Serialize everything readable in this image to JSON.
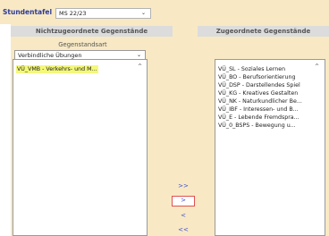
{
  "stundentafel": {
    "label": "Stundentafel",
    "value": "MS 22/23"
  },
  "headers": {
    "left": "Nichtzugeordnete Gegenstände",
    "right": "Zugeordnete Gegenstände"
  },
  "gegenstandsart": {
    "label": "Gegenstandsart",
    "value": "Verbindliche Übungen"
  },
  "left_list": [
    "VÜ_VMB - Verkehrs- und M..."
  ],
  "right_list": [
    "VÜ_SL - Soziales Lernen",
    "VÜ_BO - Berufsorientierung",
    "VÜ_DSP - Darstellendes Spiel",
    "VÜ_KG - Kreatives Gestalten",
    "VÜ_NK - Naturkundlicher Be...",
    "VÜ_IBF - Interessen- und B...",
    "VÜ_E - Lebende Fremdspra...",
    "VÜ_0_BSPS - Bewegung u..."
  ],
  "buttons": {
    "add_all": ">>",
    "add_one": ">",
    "remove_one": "<",
    "remove_all": "<<"
  },
  "icons": {
    "dropdown": "chevron-down-icon",
    "scroll_up": "scroll-up-icon"
  }
}
